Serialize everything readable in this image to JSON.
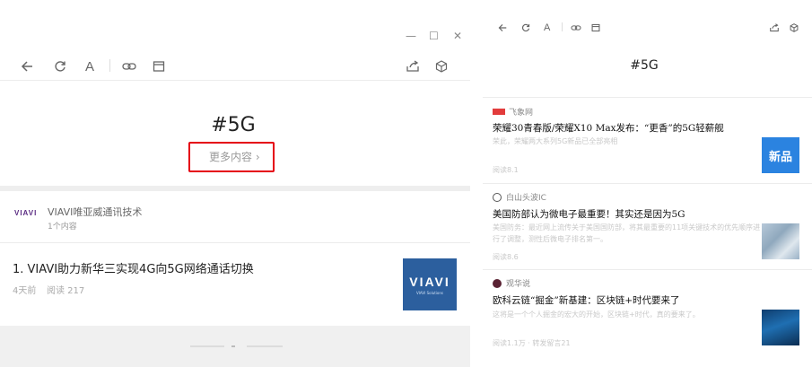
{
  "left": {
    "window_controls": {
      "minimize": "—",
      "maximize": "☐",
      "close": "✕"
    },
    "toolbar_icons": [
      "back-icon",
      "refresh-icon",
      "font-icon",
      "link-icon",
      "window-icon",
      "share-icon",
      "cube-icon"
    ],
    "toolbar_font_glyph": "A",
    "hashtag": "#5G",
    "more_link": "更多内容 ›",
    "author": {
      "avatar_text": "VIAVI",
      "name": "VIAVI唯亚威通讯技术",
      "count": "1个内容"
    },
    "article": {
      "title": "1. VIAVI助力新华三实现4G向5G网络通话切换",
      "time": "4天前",
      "reads": "阅读 217",
      "thumb_logo": "VIAVI",
      "thumb_sub": "VIAVI Solutions"
    }
  },
  "right": {
    "toolbar_icons": [
      "back-icon",
      "refresh-icon",
      "font-icon",
      "link-icon",
      "window-icon",
      "share-icon",
      "cube-icon"
    ],
    "toolbar_font_glyph": "A",
    "hashtag": "#5G",
    "articles": [
      {
        "source": "飞象网",
        "title": "荣耀30青春版/荣耀X10 Max发布：“更香”的5G轻薪舰",
        "desc": "荣此，荣耀两大系列5G新品已全部亮相",
        "meta": "阅读8.1",
        "thumb": "新品"
      },
      {
        "source": "白山头波IC",
        "title": "美国防部认为微电子最重要！其实还是因为5G",
        "desc_line1": "美国防务：最近网上流传关于美国国防部，将其最重要的11项关键技术的优先顺序进",
        "desc_line2": "行了调整，测性后微电子排名第一。",
        "meta": "阅读8.6"
      },
      {
        "source": "观华说",
        "title": "欧科云链“掘金”新基建：区块链+时代要来了",
        "desc": "这将是一个个人掘金的宏大的开始，区块链+时代，真的要来了。",
        "meta": "阅读1.1万 · 转发留言21"
      }
    ]
  },
  "colors": {
    "highlight_red": "#e50012",
    "viavi_purple": "#5b2c83",
    "new_blue": "#2b83e0"
  }
}
